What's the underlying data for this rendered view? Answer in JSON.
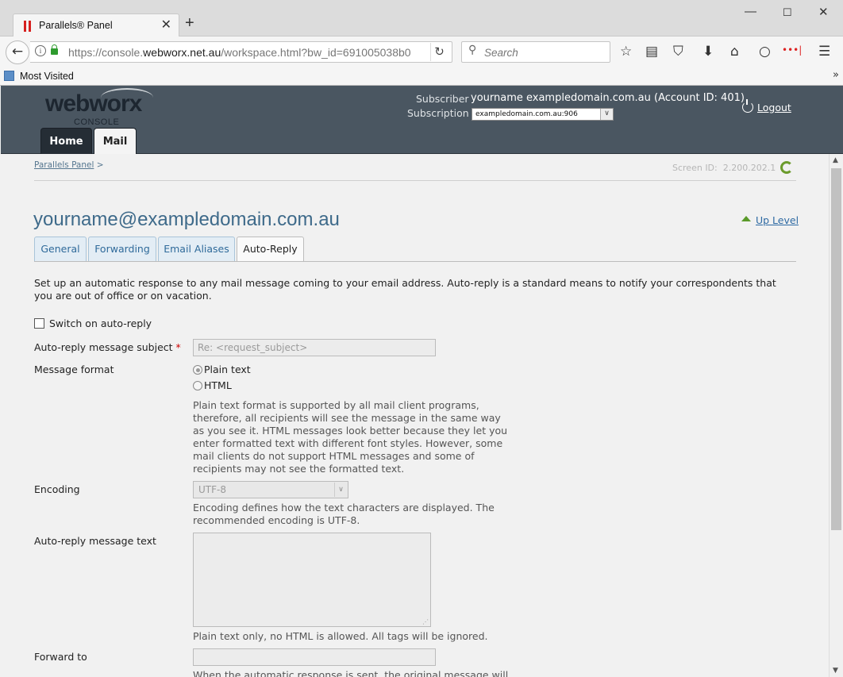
{
  "browser": {
    "tab_title": "Parallels® Panel",
    "url_prefix": "https://console.",
    "url_domain": "webworx.net.au",
    "url_path": "/workspace.html?bw_id=691005038b0",
    "search_placeholder": "Search",
    "bookmark_label": "Most Visited"
  },
  "header": {
    "logo_text": "webworx",
    "logo_sub": "CONSOLE",
    "subscriber_label": "Subscriber",
    "subscriber_value": "yourname exampledomain.com.au (Account ID: 401)",
    "subscription_label": "Subscription",
    "subscription_value": "exampledomain.com.au:906",
    "logout_label": "Logout",
    "tabs": [
      "Home",
      "Mail"
    ]
  },
  "content": {
    "breadcrumb_link": "Parallels Panel",
    "breadcrumb_sep": ">",
    "screen_id_label": "Screen ID:",
    "screen_id_value": "2.200.202.1",
    "title": "yourname@exampledomain.com.au",
    "up_level": "Up Level",
    "tabs": [
      "General",
      "Forwarding",
      "Email Aliases",
      "Auto-Reply"
    ],
    "intro": "Set up an automatic response to any mail message coming to your email address. Auto-reply is a standard means to notify your correspondents that you are out of office or on vacation.",
    "switch_label": "Switch on auto-reply",
    "subject_label": "Auto-reply message subject",
    "required_mark": "*",
    "subject_value": "Re: <request_subject>",
    "format_label": "Message format",
    "format_plain": "Plain text",
    "format_html": "HTML",
    "format_help": "Plain text format is supported by all mail client programs, therefore, all recipients will see the message in the same way as you see it. HTML messages look better because they let you enter formatted text with different font styles. However, some mail clients do not support HTML messages and some of recipients may not see the formatted text.",
    "encoding_label": "Encoding",
    "encoding_value": "UTF-8",
    "encoding_help": "Encoding defines how the text characters are displayed. The recommended encoding is UTF-8.",
    "message_label": "Auto-reply message text",
    "message_help": "Plain text only, no HTML is allowed. All tags will be ignored.",
    "forward_label": "Forward to",
    "forward_help": "When the automatic response is sent, the original message will be"
  }
}
